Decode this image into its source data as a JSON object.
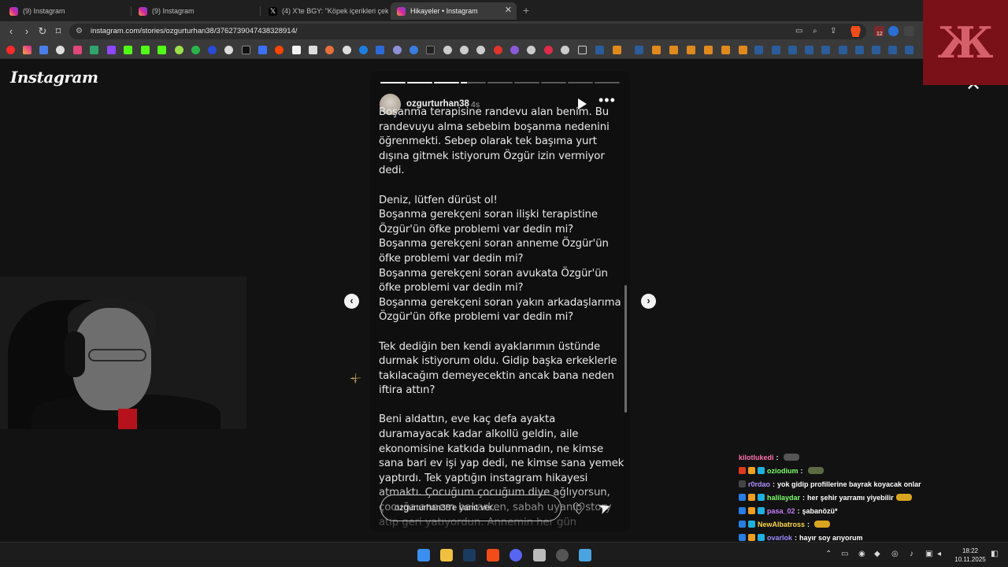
{
  "browser": {
    "tabs": [
      {
        "title": "(9) Instagram",
        "icon": "instagram-icon",
        "active": false
      },
      {
        "title": "(9) Instagram",
        "icon": "instagram-icon",
        "active": false
      },
      {
        "title": "(4) X'te BGY: \"Köpek içerikleri çeken",
        "icon": "x-icon",
        "active": false
      },
      {
        "title": "Hikayeler • Instagram",
        "icon": "instagram-icon",
        "active": true
      }
    ],
    "url": "instagram.com/stories/ozgurturhan38/3762739047438328914/",
    "extension_badge": "12"
  },
  "page": {
    "logo": "Instagram",
    "close_glyph": "✕"
  },
  "story": {
    "username": "ozgurturhan38",
    "time_ago": "4s",
    "segments_total": 9,
    "segment_progress": [
      1,
      1,
      1,
      0.25,
      0,
      0,
      0,
      0,
      0
    ],
    "text": "Boşanma terapisine randevu alan benim. Bu randevuyu alma sebebim boşanma nedenini öğrenmekti. Sebep olarak tek başıma yurt dışına gitmek istiyorum Özgür izin vermiyor dedi.\n\nDeniz, lütfen dürüst ol!\nBoşanma gerekçeni soran ilişki terapistine Özgür'ün öfke problemi var dedin mi?\nBoşanma gerekçeni soran anneme Özgür'ün öfke problemi var dedin mi?\nBoşanma gerekçeni soran avukata Özgür'ün öfke problemi var dedin mi?\nBoşanma gerekçeni soran yakın arkadaşlarıma Özgür'ün öfke problemi var dedin mi?\n\nTek dediğin ben kendi ayaklarımın üstünde durmak istiyorum oldu. Gidip başka erkeklerle takılacağım demeyecektin ancak bana neden iftira attın?\n\nBeni aldattın, eve kaç defa ayakta duramayacak kadar alkollü geldin, aile ekonomisine katkıda bulunmadın, ne kimse sana bari ev işi yap dedi, ne kimse sana yemek yaptırdı. Tek yaptığın instagram hikayesi atmaktı. Çocuğum çocuğum diye ağlıyorsun, çocuğa annem bakarken, sabah uyanıp story atıp geri yatıyordun. Annemin her gün Silivri'den kalkıp geldiğini artık tüm mahalle biliyor, utanmadan bir de anneme iftira atıyorsun",
    "reply_placeholder": "ozgurturhan38'e yanıt ver...",
    "prev_glyph": "‹",
    "next_glyph": "›"
  },
  "chat": [
    {
      "user": "kilotlukedi",
      "color": "#ff6fb1",
      "badges": [],
      "message": "",
      "emote": "#555555"
    },
    {
      "user": "oziodium",
      "color": "#7cff6b",
      "badges": [
        "#e0391a",
        "#f0a020",
        "#20b0e0"
      ],
      "message": "",
      "emote": "#5d6b44"
    },
    {
      "user": "r0rdao",
      "color": "#b28cff",
      "badges": [
        "#444"
      ],
      "message": "yok gidip profillerine bayrak koyacak onlar",
      "emote": ""
    },
    {
      "user": "halilaydar",
      "color": "#7cff6b",
      "badges": [
        "#2a7de1",
        "#f0a020",
        "#20b0e0"
      ],
      "message": "her şehir yarramı yiyebilir",
      "emote": "#d9a520"
    },
    {
      "user": "pasa_02",
      "color": "#c77dff",
      "badges": [
        "#2a7de1",
        "#f0a020",
        "#20b0e0"
      ],
      "message": "şabanözü*",
      "emote": ""
    },
    {
      "user": "NewAlbatross",
      "color": "#ffd84a",
      "badges": [
        "#2a7de1",
        "#20b0e0"
      ],
      "message": "",
      "emote": "#d9a520"
    },
    {
      "user": "ovarlok",
      "color": "#9b8cff",
      "badges": [
        "#2a7de1",
        "#f0a020",
        "#20b0e0"
      ],
      "message": "hayır soy arıyorum",
      "emote": ""
    }
  ],
  "taskbar": {
    "time": "18:22",
    "date": "10.11.2025"
  },
  "overlay": {
    "stream_logo_glyph": "Ж"
  }
}
